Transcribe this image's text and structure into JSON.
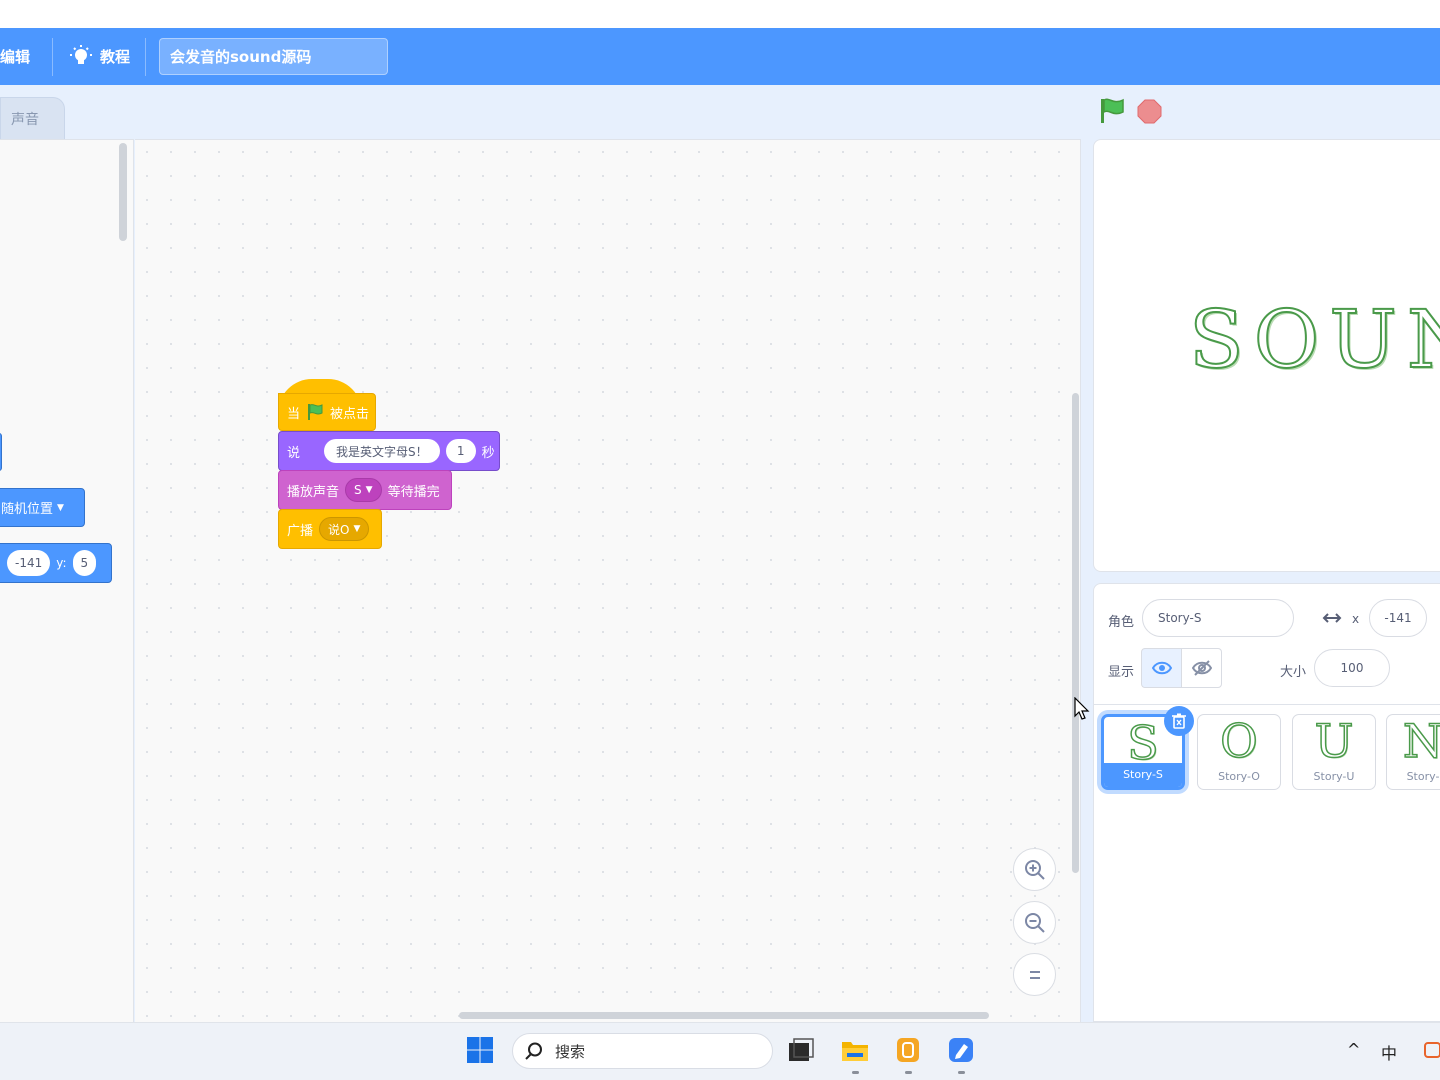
{
  "menubar": {
    "edit_label": "编辑",
    "tutorial_label": "教程",
    "project_title": "会发音的sound源码"
  },
  "tabs": {
    "sounds_label": "声音"
  },
  "palette": {
    "goto_label": "随机位置",
    "x_value": "-141",
    "y_label": "y:",
    "y_value": "5"
  },
  "script": {
    "hat_when": "当",
    "hat_clicked": "被点击",
    "say_label": "说",
    "say_text": "我是英文字母S！",
    "say_secs": "1",
    "say_unit": "秒",
    "play_label": "播放声音",
    "play_sound": "S",
    "play_wait": "等待播完",
    "broadcast_label": "广播",
    "broadcast_msg": "说O"
  },
  "stage": {
    "text": "SOUN"
  },
  "sprite_info": {
    "sprite_label": "角色",
    "sprite_name": "Story-S",
    "x_label": "x",
    "x_value": "-141",
    "show_label": "显示",
    "size_label": "大小",
    "size_value": "100"
  },
  "sprites": [
    {
      "glyph": "S",
      "name": "Story-S"
    },
    {
      "glyph": "O",
      "name": "Story-O"
    },
    {
      "glyph": "U",
      "name": "Story-U"
    },
    {
      "glyph": "N",
      "name": "Story-"
    }
  ],
  "taskbar": {
    "search_label": "搜索",
    "ime_label": "中",
    "chevron": "^"
  },
  "colors": {
    "accent": "#4c97ff",
    "events": "#ffbf00",
    "looks": "#9966ff",
    "sound": "#cf63cf",
    "motion": "#4c97ff"
  }
}
